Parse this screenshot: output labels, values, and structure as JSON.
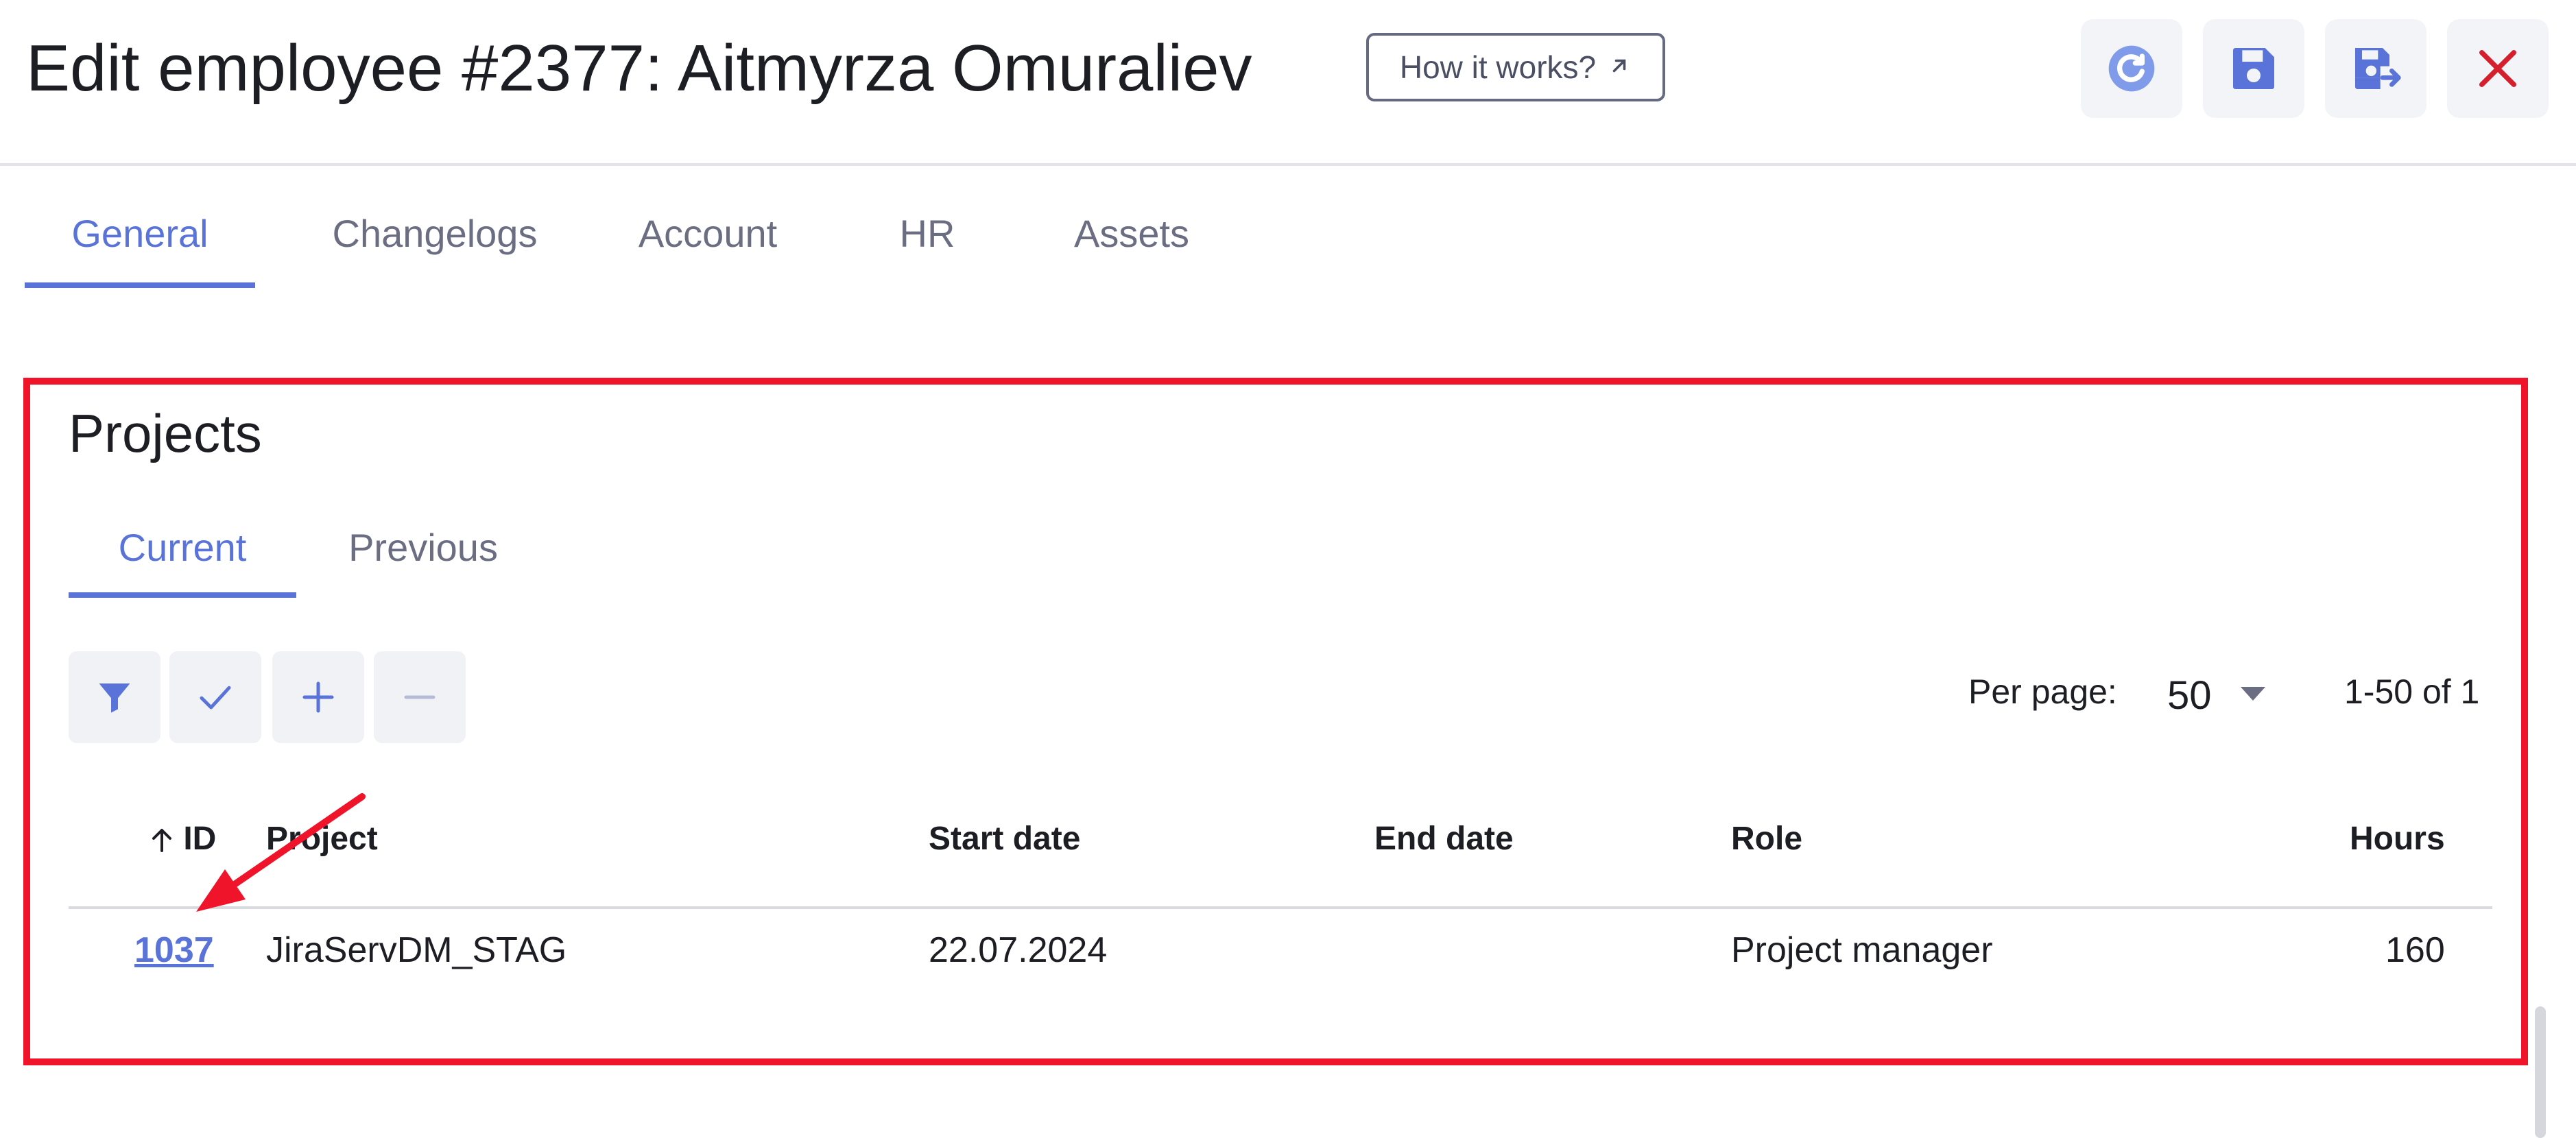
{
  "header": {
    "title": "Edit employee #2377: Aitmyrza Omuraliev",
    "how_it_works": "How it works?",
    "actions": [
      "refresh-icon",
      "save-icon",
      "save-and-exit-icon",
      "close-icon"
    ]
  },
  "tabs": [
    "General",
    "Changelogs",
    "Account",
    "HR",
    "Assets"
  ],
  "projects": {
    "title": "Projects",
    "subtabs": [
      "Current",
      "Previous"
    ],
    "toolbar": [
      "filter-icon",
      "check-icon",
      "plus-icon",
      "minus-icon"
    ],
    "per_page_label": "Per page:",
    "per_page_value": "50",
    "range": "1-50 of 1",
    "columns": [
      "ID",
      "Project",
      "Start date",
      "End date",
      "Role",
      "Hours"
    ],
    "rows": [
      {
        "id": "1037",
        "project": "JiraServDM_STAG",
        "start_date": "22.07.2024",
        "end_date": "",
        "role": "Project manager",
        "hours": "160"
      }
    ]
  },
  "colors": {
    "accent": "#5a73d8",
    "annotation": "#f0142b",
    "close": "#d61f2c"
  }
}
